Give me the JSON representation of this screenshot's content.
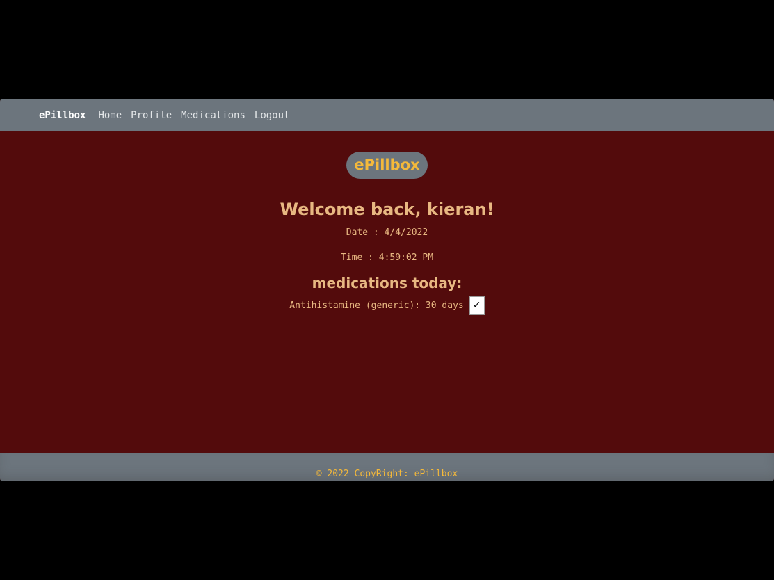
{
  "navbar": {
    "brand": "ePillbox",
    "links": [
      "Home",
      "Profile",
      "Medications",
      "Logout"
    ]
  },
  "main": {
    "logo": "ePillbox",
    "welcome": "Welcome back, kieran!",
    "date": "Date : 4/4/2022",
    "time": "Time : 4:59:02 PM",
    "medications_title": "medications today:",
    "medications": [
      {
        "text": "Antihistamine (generic): 30 days",
        "checked": true,
        "check_glyph": "✓"
      }
    ]
  },
  "footer": {
    "text": "© 2022 CopyRight: ePillbox"
  },
  "colors": {
    "page_bg": "#000000",
    "app_bg": "#530b0c",
    "bar_bg": "#6c757d",
    "accent_gold": "#f5b93a",
    "text_tan": "#e8b882"
  }
}
